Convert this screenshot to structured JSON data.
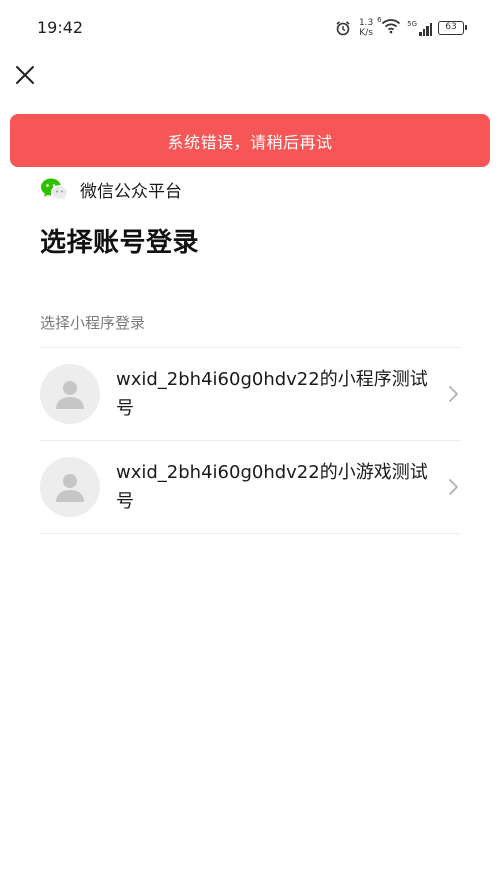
{
  "status_bar": {
    "time": "19:42",
    "net_speed_value": "1.3",
    "net_speed_unit": "K/s",
    "signal_label": "5G",
    "wifi_label": "6",
    "battery": "63"
  },
  "toast": {
    "message": "系统错误，请稍后再试",
    "color": "#f75656"
  },
  "brand": {
    "name": "微信公众平台",
    "logo_icon": "wechat-logo-icon"
  },
  "page": {
    "title": "选择账号登录",
    "section_label": "选择小程序登录"
  },
  "accounts": [
    {
      "name": "wxid_2bh4i60g0hdv22的小程序测试号",
      "avatar_icon": "default-avatar-icon"
    },
    {
      "name": "wxid_2bh4i60g0hdv22的小游戏测试号",
      "avatar_icon": "default-avatar-icon"
    }
  ]
}
